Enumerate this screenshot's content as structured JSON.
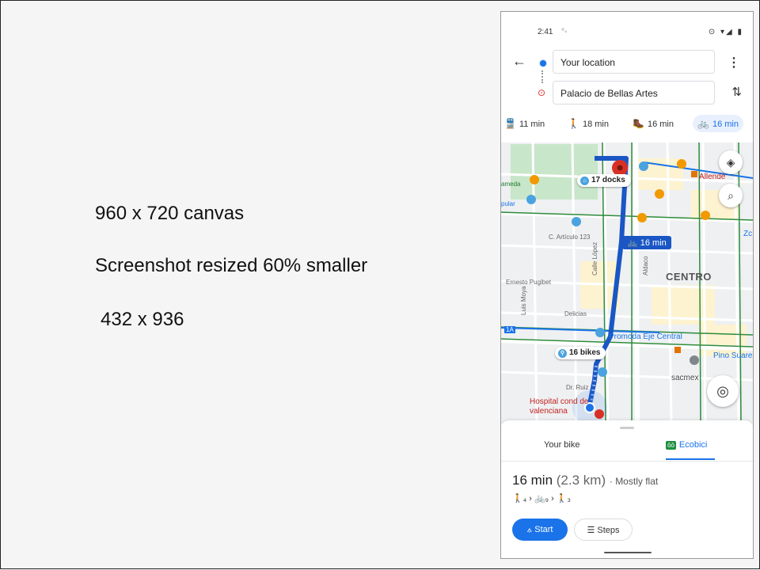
{
  "slide": {
    "line1": "960 x 720 canvas",
    "line2": "Screenshot resized  60% smaller",
    "line3": "432 x 936"
  },
  "status_bar": {
    "time": "2:41",
    "extra": "°◦",
    "icons": "⊙ ▾◢ ▮"
  },
  "search": {
    "origin": "Your location",
    "destination": "Palacio de Bellas Artes"
  },
  "modes": [
    {
      "icon": "transit-icon",
      "label": "11 min"
    },
    {
      "icon": "walk-icon",
      "label": "18 min"
    },
    {
      "icon": "hike-icon",
      "label": "16 min"
    },
    {
      "icon": "bike-icon",
      "label": "16 min",
      "selected": true
    }
  ],
  "map": {
    "docks_chip": "17 docks",
    "bikes_chip": "16 bikes",
    "route_label": "16 min",
    "district": "CENTRO",
    "labels": {
      "alameda": "ameda",
      "popular": "pular",
      "allende": "Allende",
      "articulo": "C. Artículo 123",
      "calle_lopez": "Calle López",
      "aldaco": "Aldaco",
      "ernesto": "Ernesto Pugibet",
      "luis_moya": "Luis Moya",
      "delicias": "Delicias",
      "promoda": "Promoda Eje Central",
      "pino": "Pino Suare",
      "sacmex": "sacmex",
      "hospital": "Hospital cond de valenciana",
      "dr_ruiz": "Dr. Ruiz",
      "zc": "Zc",
      "one_a": "1A"
    }
  },
  "sheet": {
    "tab_your_bike": "Your bike",
    "tab_ecobici": "Ecobici",
    "duration": "16 min",
    "distance": "(2.3 km)",
    "terrain": "Mostly flat",
    "steps_summary": "🚶₄ › 🚲₉ › 🚶₃",
    "start": "Start",
    "steps": "Steps"
  },
  "colors": {
    "accent": "#1a73e8",
    "route": "#1a56c4",
    "ecobici": "#1e8e3e",
    "bike_lane": "#2e8b3a",
    "destination": "#d93025"
  }
}
